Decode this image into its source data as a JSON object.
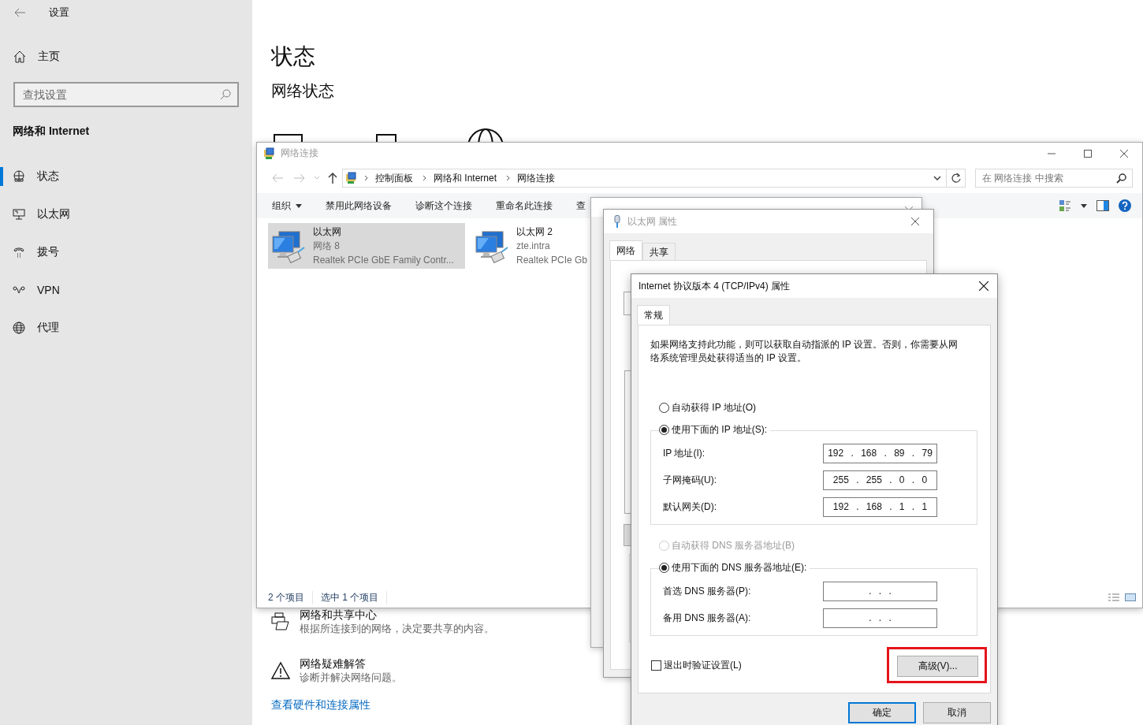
{
  "settings": {
    "title": "设置",
    "home": "主页",
    "search": {
      "placeholder": "查找设置"
    },
    "section": "网络和 Internet",
    "nav": [
      {
        "label": "状态",
        "kind": "status",
        "selected": true
      },
      {
        "label": "以太网",
        "kind": "ethernet",
        "selected": false
      },
      {
        "label": "拨号",
        "kind": "dialup",
        "selected": false
      },
      {
        "label": "VPN",
        "kind": "vpn",
        "selected": false
      },
      {
        "label": "代理",
        "kind": "proxy",
        "selected": false
      }
    ],
    "page_title": "状态",
    "subtitle": "网络状态",
    "links": [
      {
        "kind": "sharing",
        "title": "网络和共享中心",
        "description": "根据所连接到的网络，决定要共享的内容。"
      },
      {
        "kind": "warning",
        "title": "网络疑难解答",
        "description": "诊断并解决网络问题。"
      }
    ],
    "hardware_link": "查看硬件和连接属性"
  },
  "explorer": {
    "title": "网络连接",
    "breadcrumb": [
      "控制面板",
      "网络和 Internet",
      "网络连接"
    ],
    "search": {
      "placeholder": "在 网络连接 中搜索"
    },
    "commands": [
      {
        "label": "组织",
        "dropdown": true
      },
      {
        "label": "禁用此网络设备",
        "dropdown": false
      },
      {
        "label": "诊断这个连接",
        "dropdown": false
      },
      {
        "label": "重命名此连接",
        "dropdown": false
      },
      {
        "label": "查",
        "dropdown": false
      }
    ],
    "items": [
      {
        "name": "以太网",
        "network": "网络 8",
        "adapter": "Realtek PCIe GbE Family Contr...",
        "selected": true
      },
      {
        "name": "以太网 2",
        "network": "zte.intra",
        "adapter": "Realtek PCIe Gb",
        "selected": false
      }
    ],
    "status_bar": [
      "2 个项目",
      "选中 1 个项目"
    ]
  },
  "properties_dialog": {
    "title": "以太网 属性",
    "tabs": [
      {
        "label": "网络",
        "selected": true
      },
      {
        "label": "共享",
        "selected": false
      }
    ]
  },
  "ipv4_dialog": {
    "title": "Internet 协议版本 4 (TCP/IPv4) 属性",
    "tabs": [
      {
        "label": "常规",
        "selected": true
      }
    ],
    "description": "如果网络支持此功能，则可以获取自动指派的 IP 设置。否则，你需要从网络系统管理员处获得适当的 IP 设置。",
    "ip_auto": {
      "label": "自动获得 IP 地址(O)",
      "selected": false,
      "disabled": false
    },
    "ip_manual": {
      "label": "使用下面的 IP 地址(S):",
      "selected": true,
      "disabled": false
    },
    "ip_fields": [
      {
        "label": "IP 地址(I):",
        "value": "192 . 168 . 89 . 79"
      },
      {
        "label": "子网掩码(U):",
        "value": "255 . 255 . 0 . 0"
      },
      {
        "label": "默认网关(D):",
        "value": "192 . 168 . 1 . 1"
      }
    ],
    "dns_auto": {
      "label": "自动获得 DNS 服务器地址(B)",
      "selected": false,
      "disabled": true
    },
    "dns_manual": {
      "label": "使用下面的 DNS 服务器地址(E):",
      "selected": true,
      "disabled": false
    },
    "dns_fields": [
      {
        "label": "首选 DNS 服务器(P):",
        "value": ". . ."
      },
      {
        "label": "备用 DNS 服务器(A):",
        "value": ". . ."
      }
    ],
    "validate": {
      "label": "退出时验证设置(L)",
      "checked": false
    },
    "advanced": {
      "label": "高级(V)...",
      "highlighted": true
    },
    "buttons": [
      {
        "label": "确定",
        "default": true
      },
      {
        "label": "取消",
        "default": false
      }
    ]
  }
}
